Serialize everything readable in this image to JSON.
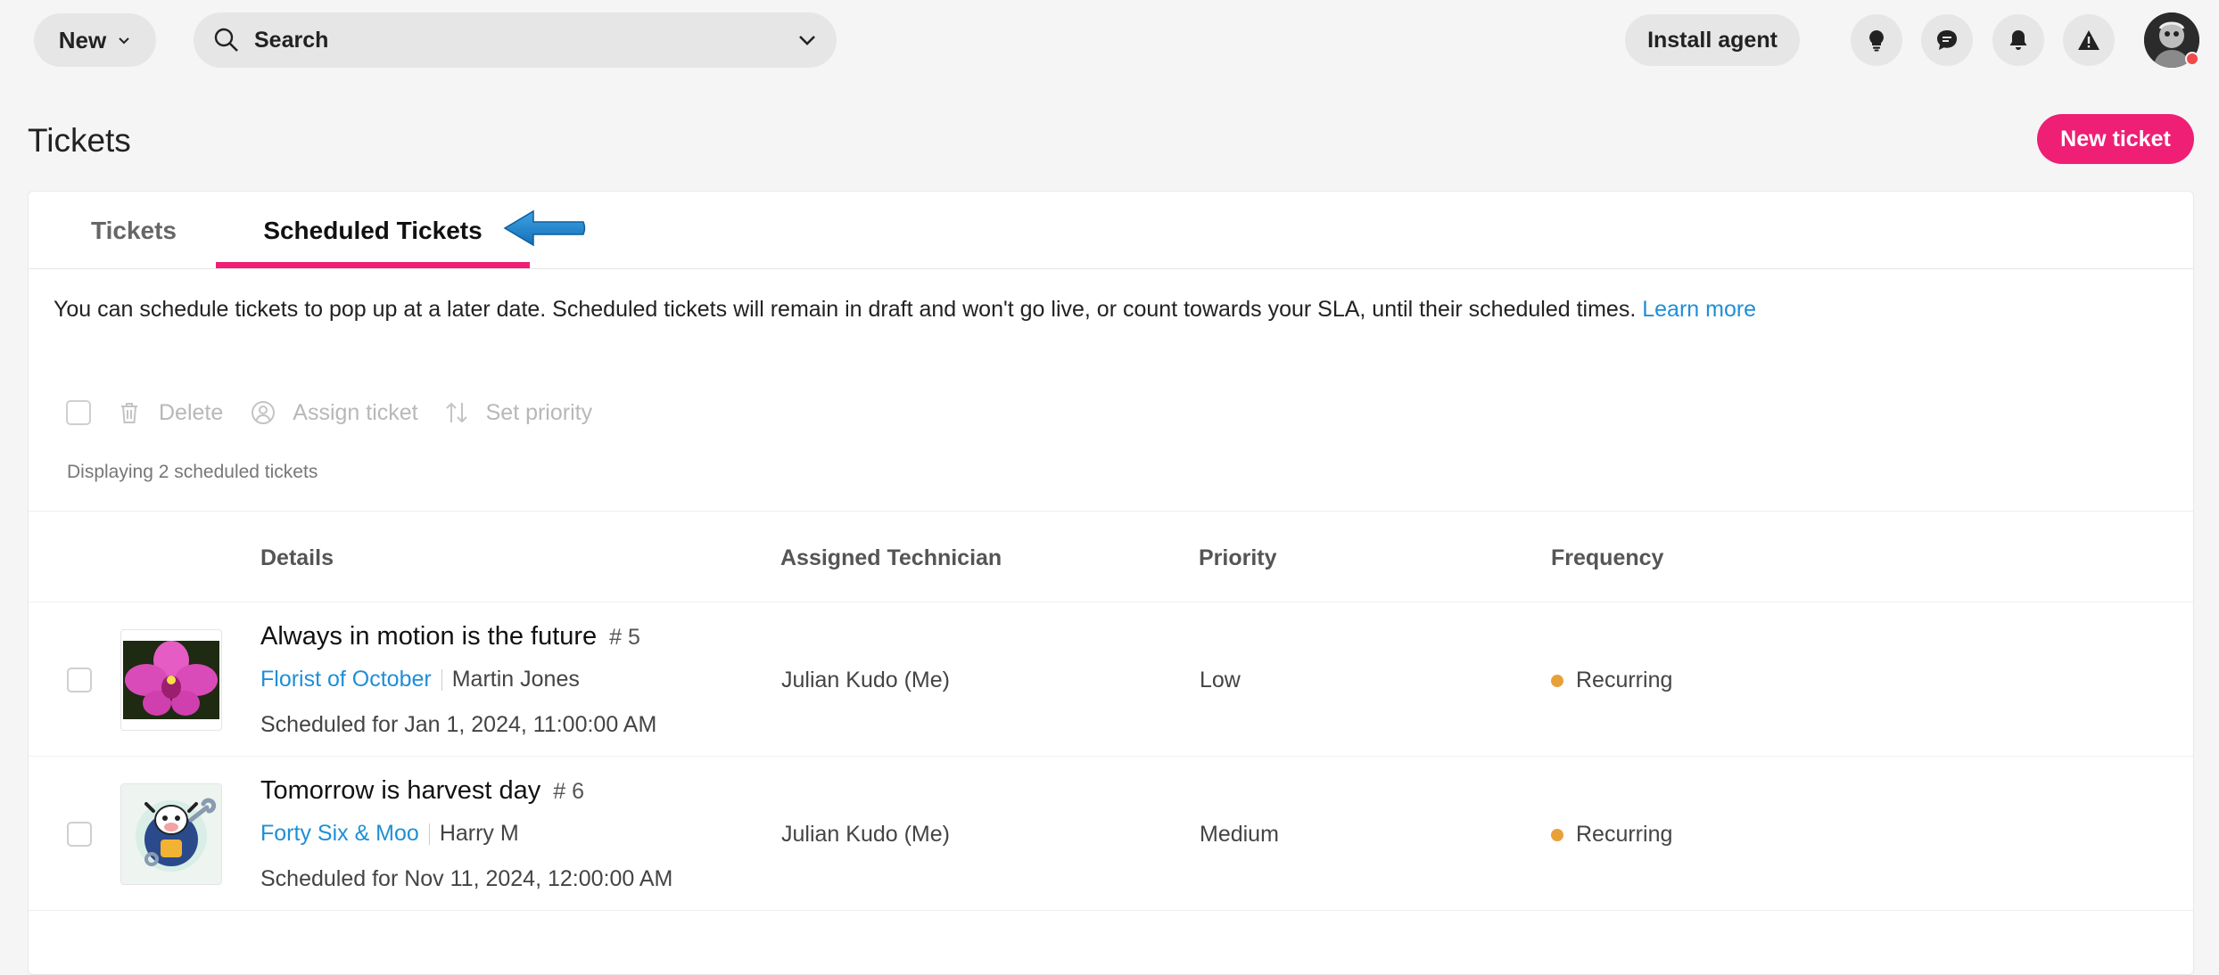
{
  "topbar": {
    "new_label": "New",
    "search_label": "Search",
    "install_label": "Install agent",
    "icons": [
      "lightbulb-icon",
      "chat-icon",
      "bell-icon",
      "alert-icon"
    ]
  },
  "page": {
    "title": "Tickets",
    "new_ticket_label": "New ticket"
  },
  "tabs": [
    {
      "label": "Tickets",
      "active": false
    },
    {
      "label": "Scheduled Tickets",
      "active": true
    }
  ],
  "info": {
    "text": "You can schedule tickets to pop up at a later date. Scheduled tickets will remain in draft and won't go live, or count towards your SLA, until their scheduled times.",
    "link": "Learn more"
  },
  "toolbar": {
    "delete": "Delete",
    "assign": "Assign ticket",
    "priority": "Set priority"
  },
  "count_text": "Displaying 2 scheduled tickets",
  "table": {
    "columns": [
      "Details",
      "Assigned Technician",
      "Priority",
      "Frequency"
    ],
    "rows": [
      {
        "title": "Always in motion is the future",
        "number": "# 5",
        "client": "Florist of October",
        "contact": "Martin Jones",
        "scheduled": "Scheduled for Jan 1, 2024, 11:00:00 AM",
        "technician": "Julian Kudo (Me)",
        "priority": "Low",
        "frequency": "Recurring"
      },
      {
        "title": "Tomorrow is harvest day",
        "number": "# 6",
        "client": "Forty Six & Moo",
        "contact": "Harry M",
        "scheduled": "Scheduled for Nov 11, 2024, 12:00:00 AM",
        "technician": "Julian Kudo (Me)",
        "priority": "Medium",
        "frequency": "Recurring"
      }
    ]
  },
  "colors": {
    "accent": "#ee1f74",
    "link": "#1f8fd6",
    "recurring_dot": "#e8a13a",
    "annotation_arrow": "#1a7ec8"
  }
}
